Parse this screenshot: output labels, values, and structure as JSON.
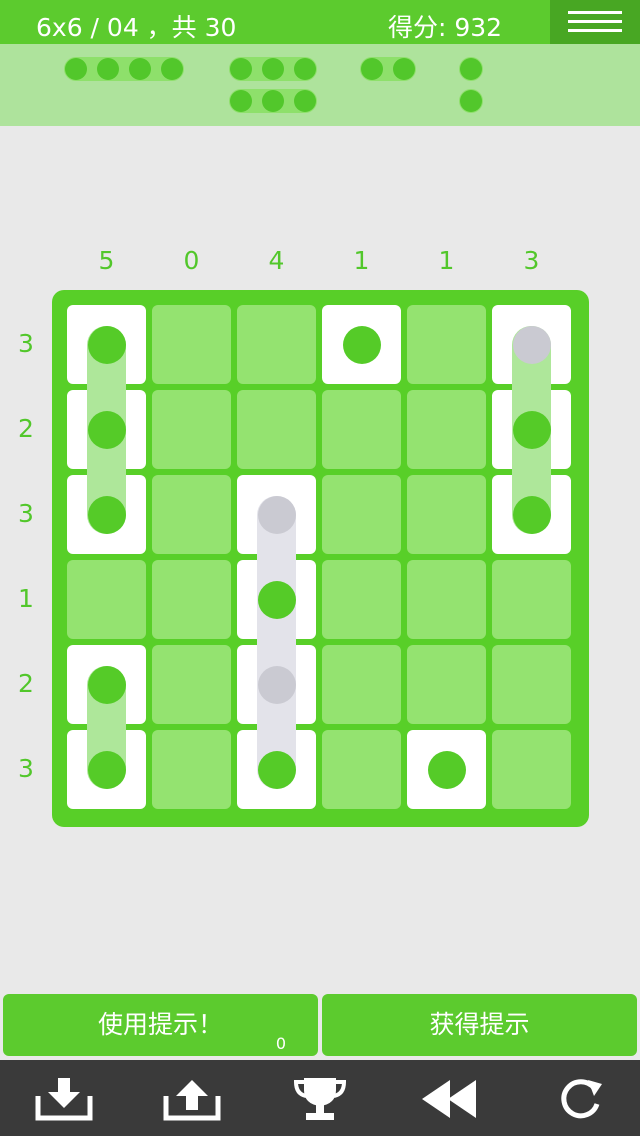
{
  "header": {
    "level_text": "6x6 / 04 ，共 30",
    "score_text": "得分: 932",
    "menu_icon": "hamburger-menu-icon"
  },
  "pieces": [
    {
      "length": 4,
      "row": 0,
      "col": 0
    },
    {
      "length": 3,
      "row": 0,
      "col": 1
    },
    {
      "length": 2,
      "row": 0,
      "col": 2
    },
    {
      "length": 1,
      "row": 0,
      "col": 3
    },
    {
      "length": 3,
      "row": 1,
      "col": 1
    },
    {
      "length": 1,
      "row": 1,
      "col": 3
    }
  ],
  "puzzle": {
    "col_clues": [
      "5",
      "0",
      "4",
      "1",
      "1",
      "3"
    ],
    "row_clues": [
      "3",
      "2",
      "3",
      "1",
      "2",
      "3"
    ],
    "white_cells": [
      [
        0,
        0
      ],
      [
        0,
        3
      ],
      [
        0,
        5
      ],
      [
        1,
        0
      ],
      [
        1,
        5
      ],
      [
        2,
        0
      ],
      [
        2,
        2
      ],
      [
        2,
        5
      ],
      [
        3,
        2
      ],
      [
        4,
        0
      ],
      [
        4,
        2
      ],
      [
        5,
        0
      ],
      [
        5,
        2
      ],
      [
        5,
        4
      ]
    ],
    "bands": [
      {
        "col": 0,
        "row_start": 0,
        "row_end": 2,
        "color": "green"
      },
      {
        "col": 5,
        "row_start": 0,
        "row_end": 2,
        "color": "green"
      },
      {
        "col": 0,
        "row_start": 4,
        "row_end": 5,
        "color": "green"
      },
      {
        "col": 2,
        "row_start": 2,
        "row_end": 5,
        "color": "gray"
      }
    ],
    "dots": [
      {
        "row": 0,
        "col": 0,
        "color": "green"
      },
      {
        "row": 1,
        "col": 0,
        "color": "green"
      },
      {
        "row": 2,
        "col": 0,
        "color": "green"
      },
      {
        "row": 0,
        "col": 3,
        "color": "green"
      },
      {
        "row": 0,
        "col": 5,
        "color": "gray"
      },
      {
        "row": 1,
        "col": 5,
        "color": "green"
      },
      {
        "row": 2,
        "col": 5,
        "color": "green"
      },
      {
        "row": 2,
        "col": 2,
        "color": "gray"
      },
      {
        "row": 3,
        "col": 2,
        "color": "green"
      },
      {
        "row": 4,
        "col": 2,
        "color": "gray"
      },
      {
        "row": 5,
        "col": 2,
        "color": "green"
      },
      {
        "row": 4,
        "col": 0,
        "color": "green"
      },
      {
        "row": 5,
        "col": 0,
        "color": "green"
      },
      {
        "row": 5,
        "col": 4,
        "color": "green"
      }
    ]
  },
  "buttons": {
    "use_hint_label": "使用提示！",
    "hint_count": "0",
    "get_hint_label": "获得提示"
  },
  "toolbar": {
    "items": [
      "download-icon",
      "upload-icon",
      "trophy-icon",
      "rewind-icon",
      "restart-icon"
    ]
  },
  "colors": {
    "primary_green": "#5ccb2e",
    "cell_green": "#94e370",
    "dot_green": "#55cb28",
    "dot_gray": "#cacad2"
  }
}
